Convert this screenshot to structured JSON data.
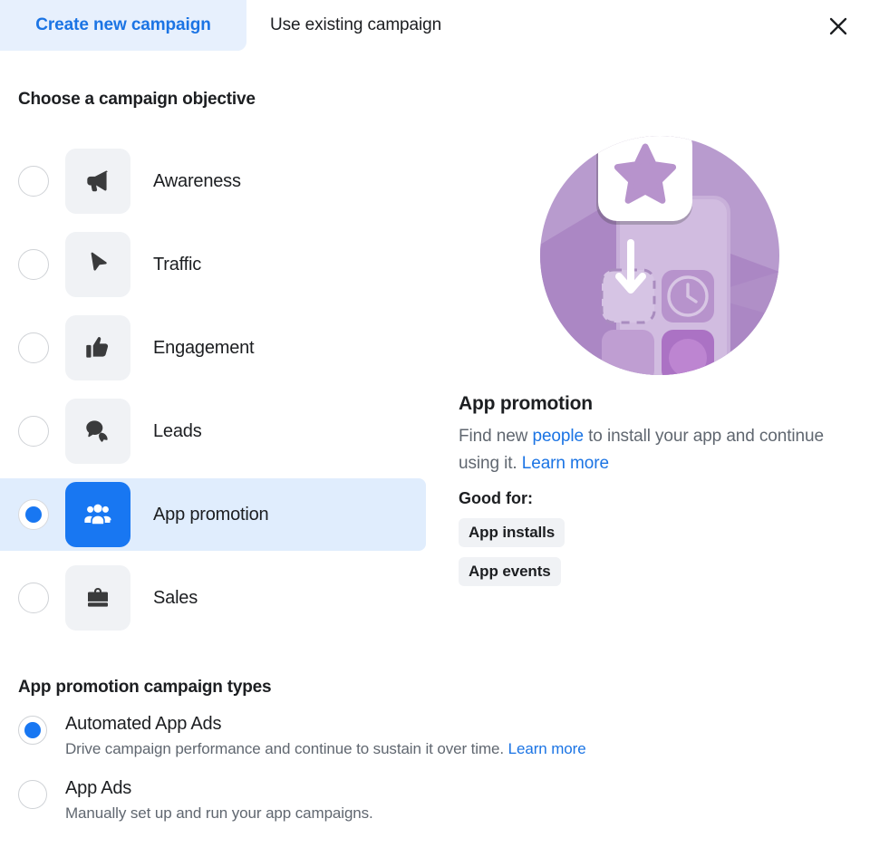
{
  "tabs": [
    {
      "label": "Create new campaign",
      "active": true
    },
    {
      "label": "Use existing campaign",
      "active": false
    }
  ],
  "close_icon": "close-icon",
  "objective_section": {
    "heading": "Choose a campaign objective",
    "items": [
      {
        "label": "Awareness",
        "icon": "megaphone-icon",
        "selected": false
      },
      {
        "label": "Traffic",
        "icon": "cursor-icon",
        "selected": false
      },
      {
        "label": "Engagement",
        "icon": "thumbs-up-icon",
        "selected": false
      },
      {
        "label": "Leads",
        "icon": "chat-bubble-icon",
        "selected": false
      },
      {
        "label": "App promotion",
        "icon": "people-icon",
        "selected": true
      },
      {
        "label": "Sales",
        "icon": "shopping-bag-icon",
        "selected": false
      }
    ]
  },
  "detail": {
    "illustration": "app-promotion-illustration",
    "title": "App promotion",
    "desc_part1": "Find new ",
    "desc_link1": "people",
    "desc_part2": " to install your app and continue using it. ",
    "desc_link2": "Learn more",
    "good_for_label": "Good for:",
    "pills": [
      "App installs",
      "App events"
    ]
  },
  "campaign_types": {
    "heading": "App promotion campaign types",
    "items": [
      {
        "name": "Automated App Ads",
        "desc": "Drive campaign performance and continue to sustain it over time.",
        "link": "Learn more",
        "selected": true
      },
      {
        "name": "App Ads",
        "desc": "Manually set up and run your app campaigns.",
        "link": "",
        "selected": false
      }
    ]
  },
  "colors": {
    "accent_blue": "#1877f2",
    "link_blue": "#1b74e4",
    "tab_active_bg": "#e7f0fd",
    "row_selected_bg": "#e0edfd",
    "tile_bg": "#f0f2f5",
    "illustration_purple": "#b394c8",
    "text_primary": "#1c1e21",
    "text_secondary": "#606770"
  }
}
